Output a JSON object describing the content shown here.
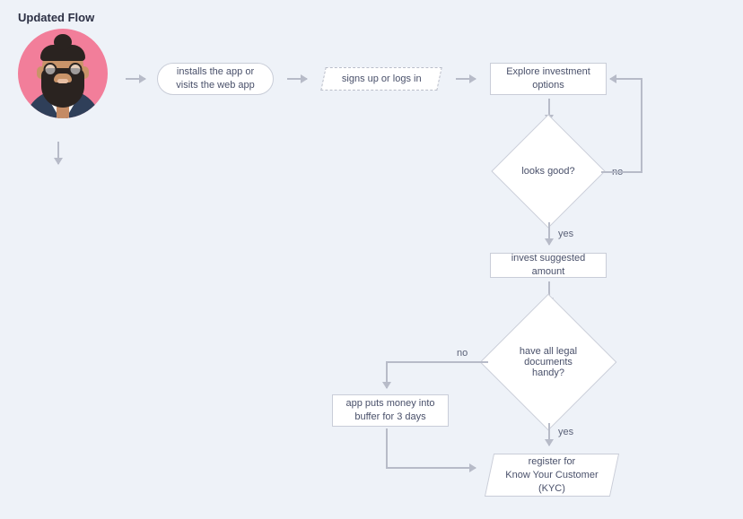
{
  "title": "Updated Flow",
  "nodes": {
    "install": "installs the app or visits the web app",
    "signup": "signs up or logs in",
    "explore": "Explore investment options",
    "looks_good": "looks good?",
    "invest": "invest suggested amount",
    "legal_docs": "have all legal documents handy?",
    "buffer": "app puts money into buffer for 3 days",
    "kyc": "register for\nKnow Your Customer (KYC)"
  },
  "labels": {
    "no": "no",
    "yes": "yes"
  }
}
